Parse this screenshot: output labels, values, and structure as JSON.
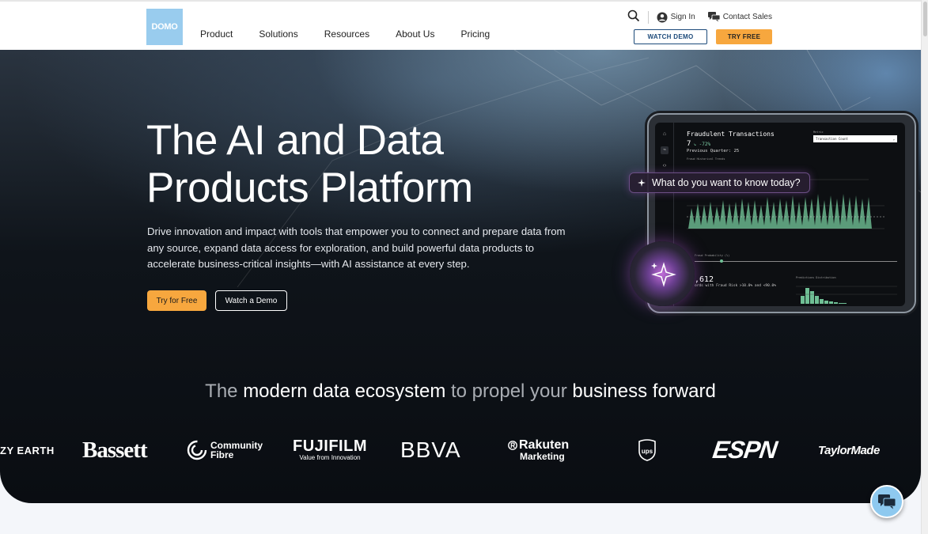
{
  "header": {
    "logo_text": "DOMO",
    "nav": [
      "Product",
      "Solutions",
      "Resources",
      "About Us",
      "Pricing"
    ],
    "sign_in": "Sign In",
    "contact_sales": "Contact Sales",
    "watch_demo": "WATCH DEMO",
    "try_free": "TRY FREE"
  },
  "hero": {
    "title_line1": "The AI and Data",
    "title_line2": "Products Platform",
    "lead": "Drive innovation and impact with tools that empower you to connect and prepare data from any source, expand data access for exploration, and build powerful data products to accelerate business-critical insights—with AI assistance at every step.",
    "cta_primary": "Try for Free",
    "cta_secondary": "Watch a Demo"
  },
  "dashboard": {
    "title": "Fraudulent Transactions",
    "value": "7",
    "change": "↘ -72%",
    "previous": "Previous Quarter: 25",
    "metric_label": "Metric",
    "metric_value": "Transaction Count",
    "section_label": "Fraud Historical Trends",
    "big_value": ",612",
    "small_text": "ords with Fraud Risk >10.0% and <90.0%",
    "prob_label": "Fraud Probability (%)",
    "dist_label": "Predictions Distribution",
    "ai_prompt": "What do you want to know today?"
  },
  "ecosystem": {
    "part1": "The ",
    "part2": "modern data ecosystem",
    "part3": " to propel your ",
    "part4": "business forward"
  },
  "logos": {
    "earth": "ZY EARTH",
    "bassett": "Bassett",
    "community_1": "Community",
    "community_2": "Fibre",
    "fujifilm": "FUJIFILM",
    "fujifilm_sub": "Value from Innovation",
    "bbva": "BBVA",
    "rakuten": "Rakuten",
    "rakuten_sub": "Marketing",
    "ups": "ups",
    "espn": "ESPN",
    "taylormade": "TaylorMade"
  },
  "colors": {
    "accent": "#f7a73e",
    "logo_bg": "#99ccee",
    "demo_border": "#1c4a7a"
  }
}
